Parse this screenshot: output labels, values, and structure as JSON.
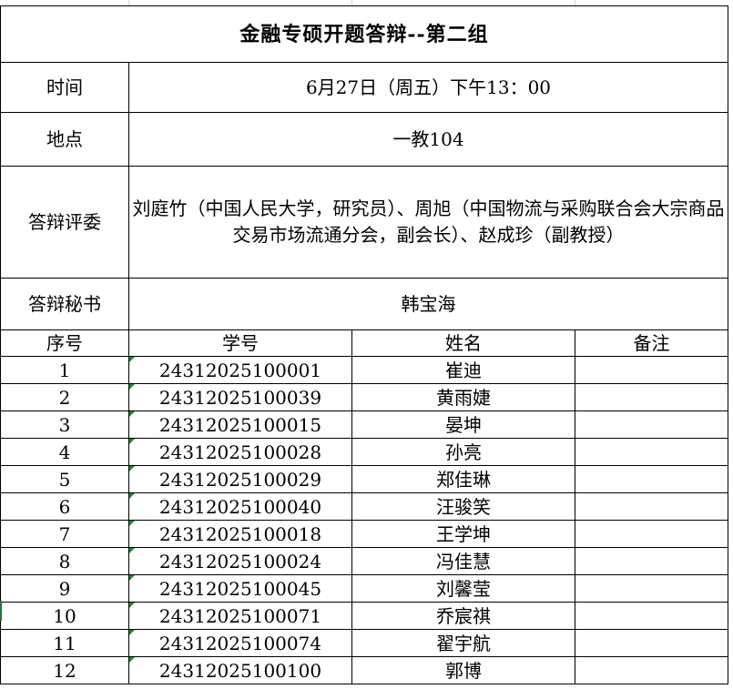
{
  "title": "金融专硕开题答辩--第二组",
  "time": {
    "label": "时间",
    "value": "6月27日（周五）下午13：00"
  },
  "place": {
    "label": "地点",
    "value": "一教104"
  },
  "panel": {
    "label": "答辩评委",
    "value": "刘庭竹（中国人民大学，研究员）、周旭（中国物流与采购联合会大宗商品交易市场流通分会，副会长）、赵成珍（副教授）"
  },
  "secretary": {
    "label": "答辩秘书",
    "value": "韩宝海"
  },
  "columns": [
    "序号",
    "学号",
    "姓名",
    "备注"
  ],
  "rows": [
    {
      "no": "1",
      "id": "24312025100001",
      "name": "崔迪",
      "note": ""
    },
    {
      "no": "2",
      "id": "24312025100039",
      "name": "黄雨婕",
      "note": ""
    },
    {
      "no": "3",
      "id": "24312025100015",
      "name": "晏坤",
      "note": ""
    },
    {
      "no": "4",
      "id": "24312025100028",
      "name": "孙亮",
      "note": ""
    },
    {
      "no": "5",
      "id": "24312025100029",
      "name": "郑佳琳",
      "note": ""
    },
    {
      "no": "6",
      "id": "24312025100040",
      "name": "汪骏笑",
      "note": ""
    },
    {
      "no": "7",
      "id": "24312025100018",
      "name": "王学坤",
      "note": ""
    },
    {
      "no": "8",
      "id": "24312025100024",
      "name": "冯佳慧",
      "note": ""
    },
    {
      "no": "9",
      "id": "24312025100045",
      "name": "刘馨莹",
      "note": ""
    },
    {
      "no": "10",
      "id": "24312025100071",
      "name": "乔宸祺",
      "note": ""
    },
    {
      "no": "11",
      "id": "24312025100074",
      "name": "翟宇航",
      "note": ""
    },
    {
      "no": "12",
      "id": "24312025100100",
      "name": "郭博",
      "note": ""
    }
  ]
}
